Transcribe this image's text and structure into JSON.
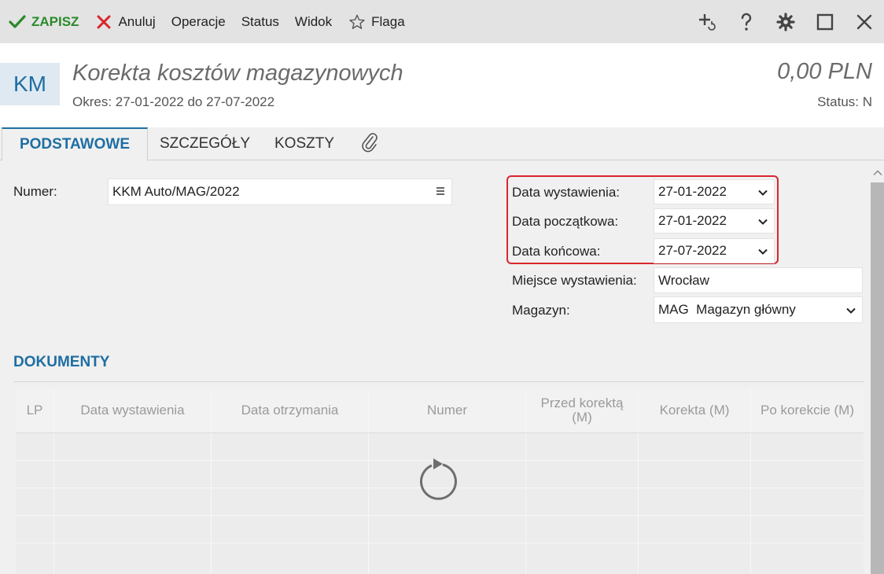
{
  "toolbar": {
    "save": "ZAPISZ",
    "cancel": "Anuluj",
    "operations": "Operacje",
    "status": "Status",
    "view": "Widok",
    "flag": "Flaga"
  },
  "header": {
    "badge": "KM",
    "title": "Korekta kosztów magazynowych",
    "period": "Okres: 27-01-2022 do 27-07-2022",
    "amount": "0,00 PLN",
    "status": "Status: N"
  },
  "tabs": [
    "PODSTAWOWE",
    "SZCZEGÓŁY",
    "KOSZTY"
  ],
  "form": {
    "number_label": "Numer:",
    "number_value": "KKM Auto/MAG/2022",
    "issue_date_label": "Data wystawienia:",
    "issue_date_value": "27-01-2022",
    "start_date_label": "Data początkowa:",
    "start_date_value": "27-01-2022",
    "end_date_label": "Data końcowa:",
    "end_date_value": "27-07-2022",
    "place_label": "Miejsce wystawienia:",
    "place_value": "Wrocław",
    "warehouse_label": "Magazyn:",
    "warehouse_value": "MAG  Magazyn główny"
  },
  "documents": {
    "title": "DOKUMENTY",
    "columns": [
      "LP",
      "Data wystawienia",
      "Data otrzymania",
      "Numer",
      "Przed korektą (M)",
      "Korekta (M)",
      "Po korekcie (M)"
    ]
  },
  "colors": {
    "accent": "#1e6ea3",
    "save_green": "#2a8a2a",
    "cancel_red": "#d9262c",
    "highlight_red": "#d9262c"
  },
  "icons": [
    "check-icon",
    "x-icon",
    "star-icon",
    "add-link-icon",
    "help-icon",
    "gear-icon",
    "maximize-icon",
    "close-icon",
    "paperclip-icon",
    "chevron-down-icon",
    "hamburger-icon",
    "refresh-spinner-icon"
  ]
}
